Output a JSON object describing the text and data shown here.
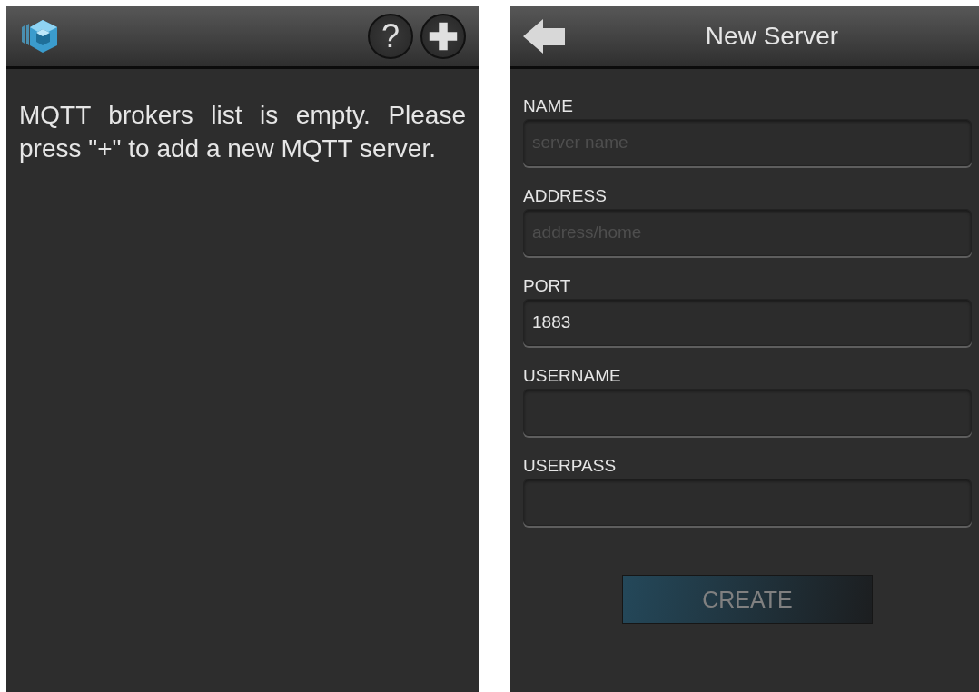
{
  "brokers_screen": {
    "message": "MQTT brokers list is empty. Please press \"+\" to add a new MQTT server.",
    "help_button": "?"
  },
  "new_server_screen": {
    "title": "New Server",
    "fields": [
      {
        "label": "NAME",
        "placeholder": "server name"
      },
      {
        "label": "ADDRESS",
        "placeholder": "address/home"
      },
      {
        "label": "PORT",
        "value": "1883"
      },
      {
        "label": "USERNAME"
      },
      {
        "label": "USERPASS"
      }
    ],
    "create_button": {
      "label": "CREATE",
      "disabled": true
    }
  }
}
